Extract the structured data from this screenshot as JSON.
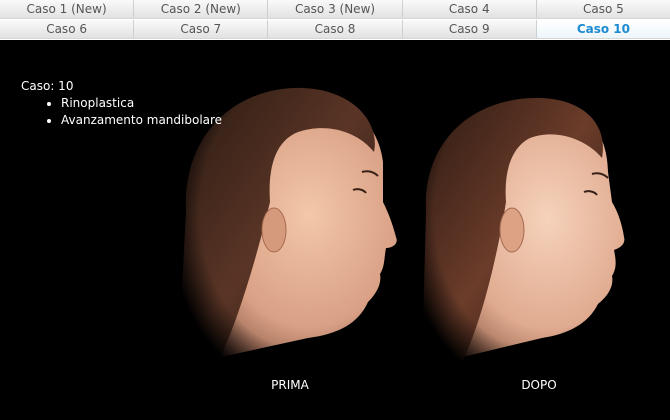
{
  "tabs": {
    "row1": [
      "Caso 1 (New)",
      "Caso 2 (New)",
      "Caso 3 (New)",
      "Caso 4",
      "Caso 5"
    ],
    "row2": [
      "Caso 6",
      "Caso 7",
      "Caso 8",
      "Caso 9",
      "Caso 10"
    ],
    "active": "Caso 10"
  },
  "case": {
    "label": "Caso: 10",
    "procedures": [
      "Rinoplastica",
      "Avanzamento mandibolare"
    ]
  },
  "photos": {
    "before_caption": "PRIMA",
    "after_caption": "DOPO"
  },
  "colors": {
    "active_tab_text": "#1c8ad1",
    "background": "#000000"
  }
}
